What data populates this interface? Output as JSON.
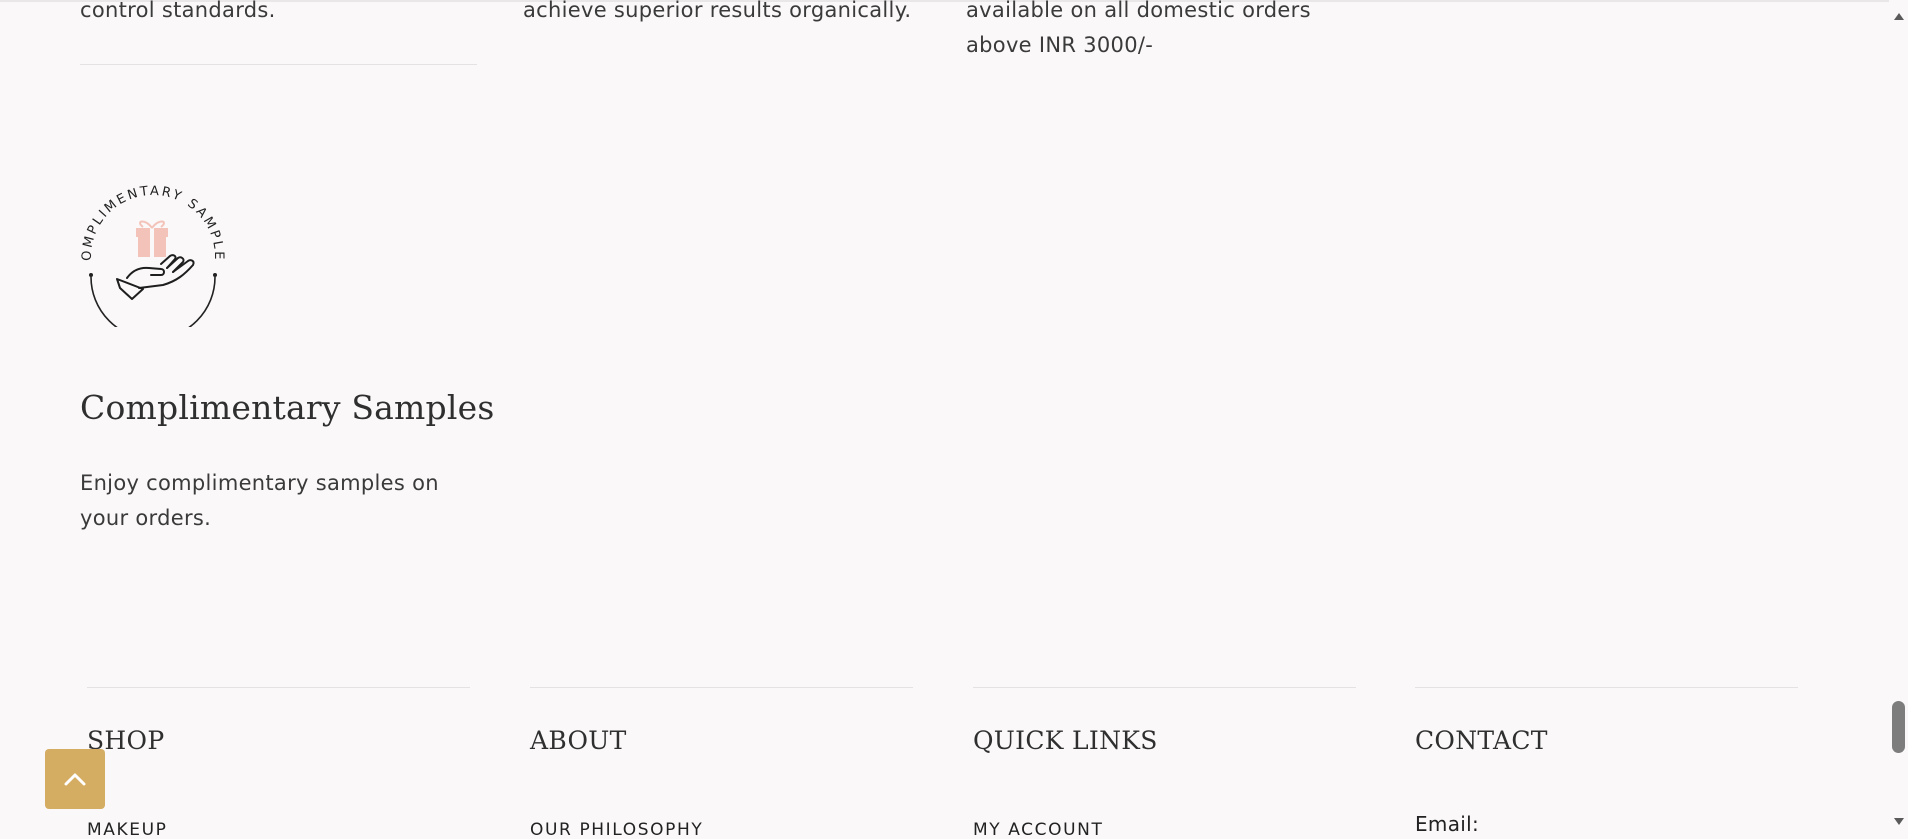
{
  "features": {
    "quality_text_fragment": "control standards.",
    "organic_text_fragment": "achieve superior results organically.",
    "shipping_text_line1": "available on all domestic orders",
    "shipping_text_line2": "above INR 3000/-",
    "samples": {
      "badge_text": "COMPLIMENTARY SAMPLES",
      "badge_icon": "gift-in-hand-icon",
      "title": "Complimentary Samples",
      "description_line1": "Enjoy complimentary samples on",
      "description_line2": "your orders."
    }
  },
  "footer": {
    "columns": [
      {
        "heading": "SHOP",
        "first_link": "MAKEUP"
      },
      {
        "heading": "ABOUT",
        "first_link": "OUR PHILOSOPHY"
      },
      {
        "heading": "QUICK LINKS",
        "first_link": "MY ACCOUNT"
      },
      {
        "heading": "CONTACT",
        "first_item": "Email:"
      }
    ]
  },
  "back_to_top": {
    "icon": "chevron-up-icon"
  },
  "colors": {
    "background": "#faf8f9",
    "accent_gold": "#d4ad62",
    "gift_pink": "#f3c3b9",
    "text_dark": "#333333"
  }
}
